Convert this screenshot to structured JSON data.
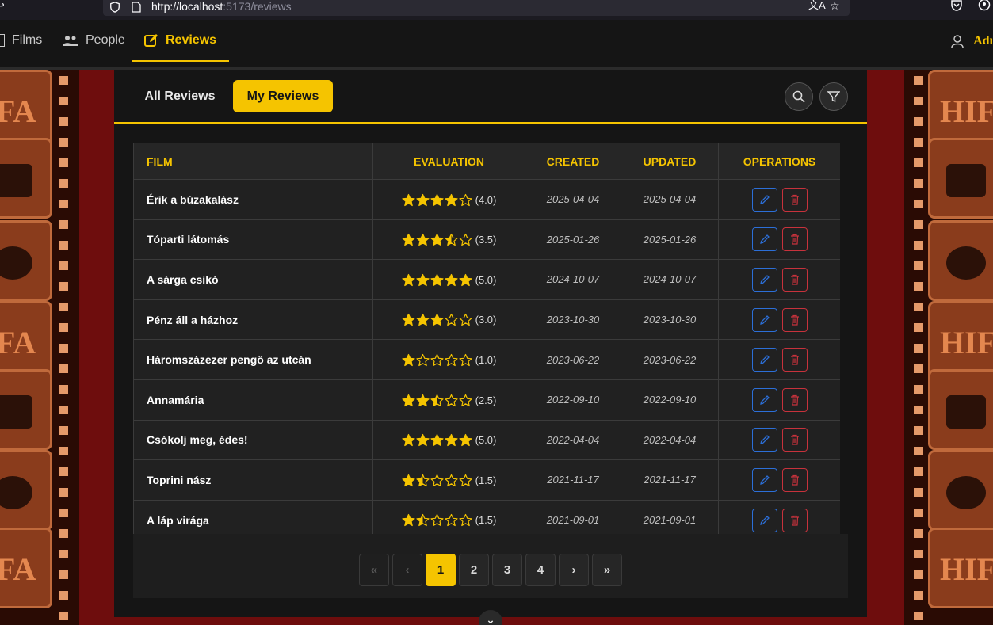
{
  "browser": {
    "url_host": "http://localhost",
    "url_rest": ":5173/reviews"
  },
  "nav": {
    "items": [
      {
        "label": "Films",
        "icon": "film-icon"
      },
      {
        "label": "People",
        "icon": "people-icon"
      },
      {
        "label": "Reviews",
        "icon": "edit-icon",
        "active": true
      }
    ],
    "user_label": "Adı"
  },
  "tabs": {
    "all": "All Reviews",
    "mine": "My Reviews"
  },
  "background": {
    "tile_word_left": "FA",
    "tile_word_right": "HIF"
  },
  "table": {
    "headers": {
      "film": "FILM",
      "evaluation": "EVALUATION",
      "created": "CREATED",
      "updated": "UPDATED",
      "operations": "OPERATIONS"
    },
    "rows": [
      {
        "film": "Érik a búzakalász",
        "rating": 4.0,
        "score": "(4.0)",
        "created": "2025-04-04",
        "updated": "2025-04-04"
      },
      {
        "film": "Tóparti látomás",
        "rating": 3.5,
        "score": "(3.5)",
        "created": "2025-01-26",
        "updated": "2025-01-26"
      },
      {
        "film": "A sárga csikó",
        "rating": 5.0,
        "score": "(5.0)",
        "created": "2024-10-07",
        "updated": "2024-10-07"
      },
      {
        "film": "Pénz áll a házhoz",
        "rating": 3.0,
        "score": "(3.0)",
        "created": "2023-10-30",
        "updated": "2023-10-30"
      },
      {
        "film": "Háromszázezer pengő az utcán",
        "rating": 1.0,
        "score": "(1.0)",
        "created": "2023-06-22",
        "updated": "2023-06-22"
      },
      {
        "film": "Annamária",
        "rating": 2.5,
        "score": "(2.5)",
        "created": "2022-09-10",
        "updated": "2022-09-10"
      },
      {
        "film": "Csókolj meg, édes!",
        "rating": 5.0,
        "score": "(5.0)",
        "created": "2022-04-04",
        "updated": "2022-04-04"
      },
      {
        "film": "Toprini nász",
        "rating": 1.5,
        "score": "(1.5)",
        "created": "2021-11-17",
        "updated": "2021-11-17"
      },
      {
        "film": "A láp virága",
        "rating": 1.5,
        "score": "(1.5)",
        "created": "2021-09-01",
        "updated": "2021-09-01"
      }
    ]
  },
  "pagination": {
    "first": "«",
    "prev": "‹",
    "pages": [
      "1",
      "2",
      "3",
      "4"
    ],
    "current": "1",
    "next": "›",
    "last": "»"
  },
  "colors": {
    "accent": "#f5c400",
    "edit": "#2c6fd8",
    "delete": "#c8323c"
  }
}
